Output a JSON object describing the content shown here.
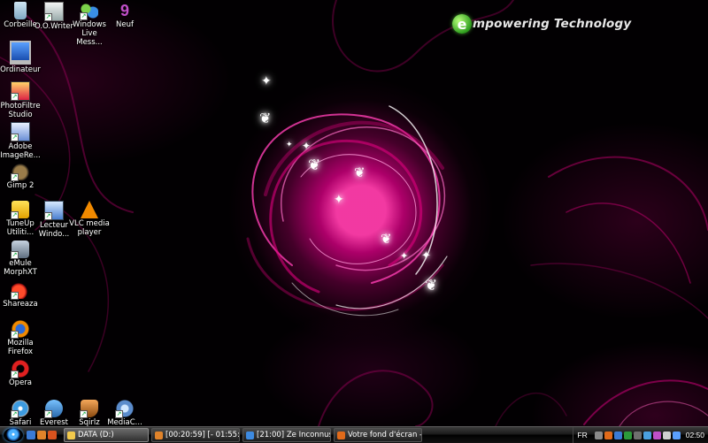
{
  "wallpaper": {
    "brand_letter": "e",
    "brand_text": "mpowering Technology",
    "accent": "#e6008c"
  },
  "desktop_icons": [
    {
      "label": "Corbeille",
      "icon": "recycle-bin-icon"
    },
    {
      "label": "O.O.Writer",
      "icon": "writer-icon"
    },
    {
      "label": "Windows\nLive Mess...",
      "icon": "messenger-icon"
    },
    {
      "label": "Neuf",
      "icon": "neuf-icon"
    },
    {
      "label": "Ordinateur",
      "icon": "computer-icon"
    },
    {
      "label": "PhotoFiltre\nStudio",
      "icon": "photofiltre-icon"
    },
    {
      "label": "Adobe\nImageRe...",
      "icon": "imageready-icon"
    },
    {
      "label": "Gimp 2",
      "icon": "gimp-icon"
    },
    {
      "label": "TuneUp\nUtiliti...",
      "icon": "tuneup-icon"
    },
    {
      "label": "Lecteur\nWindo...",
      "icon": "media-player-icon"
    },
    {
      "label": "VLC media\nplayer",
      "icon": "vlc-icon"
    },
    {
      "label": "eMule\nMorphXT",
      "icon": "emule-icon"
    },
    {
      "label": "Shareaza",
      "icon": "shareaza-icon"
    },
    {
      "label": "Mozilla\nFirefox",
      "icon": "firefox-icon"
    },
    {
      "label": "Opera",
      "icon": "opera-icon"
    },
    {
      "label": "Safari",
      "icon": "safari-icon"
    },
    {
      "label": "Everest",
      "icon": "everest-icon"
    },
    {
      "label": "Sqirlz",
      "icon": "sqirlz-icon"
    },
    {
      "label": "MediaC...",
      "icon": "mediacoder-icon"
    }
  ],
  "taskbar": {
    "start": "start-orb-icon",
    "buttons": [
      {
        "label": "DATA (D:)",
        "icon": "folder-icon",
        "color": "#f2c94c"
      },
      {
        "label": "[00:20:59] [- 01:55:54]",
        "icon": "media-icon",
        "color": "#e0832a"
      },
      {
        "label": "[21:00] Ze Inconnus ...",
        "icon": "chat-icon",
        "color": "#3d8ae0"
      },
      {
        "label": "Votre fond d'écran -...",
        "icon": "firefox-icon",
        "color": "#e06a1a"
      }
    ],
    "tray": {
      "lang": "FR",
      "clock": "02:50"
    }
  }
}
